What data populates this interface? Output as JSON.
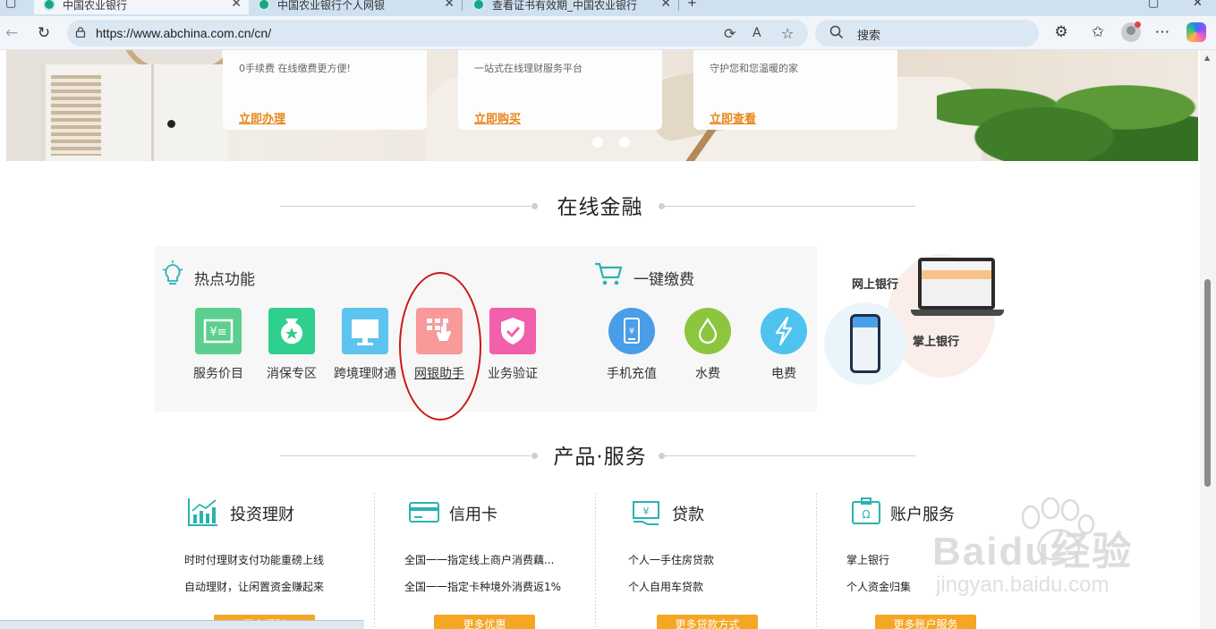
{
  "browser": {
    "tabs": [
      {
        "title": "中国农业银行"
      },
      {
        "title": "中国农业银行个人网银"
      },
      {
        "title": "查看证书有效期_中国农业银行"
      }
    ],
    "new_tab": "+",
    "url": "https://www.abchina.com.cn/cn/",
    "search_placeholder": "搜索"
  },
  "banner": {
    "promos": [
      {
        "desc": "0手续费 在线缴费更方便!",
        "cta": "立即办理"
      },
      {
        "desc": "一站式在线理财服务平台",
        "cta": "立即购买"
      },
      {
        "desc": "守护您和您温暖的家",
        "cta": "立即查看"
      }
    ]
  },
  "online_finance": {
    "title": "在线金融",
    "hot": {
      "title": "热点功能",
      "items": [
        {
          "label": "服务价目",
          "icon": "price-list-icon",
          "color": "#5ccf8f"
        },
        {
          "label": "消保专区",
          "icon": "consumer-protection-icon",
          "color": "#2fcf8e"
        },
        {
          "label": "跨境理财通",
          "icon": "monitor-icon",
          "color": "#5ec3ef"
        },
        {
          "label": "网银助手",
          "icon": "ebank-assistant-icon",
          "color": "#f79a99"
        },
        {
          "label": "业务验证",
          "icon": "shield-check-icon",
          "color": "#f25fab"
        }
      ]
    },
    "pay": {
      "title": "一键缴费",
      "items": [
        {
          "label": "手机充值",
          "icon": "mobile-recharge-icon",
          "color": "#4a9de8"
        },
        {
          "label": "水费",
          "icon": "water-drop-icon",
          "color": "#8cc63f"
        },
        {
          "label": "电费",
          "icon": "lightning-icon",
          "color": "#4fc3f0"
        }
      ]
    },
    "ebank": {
      "online": "网上银行",
      "mobile": "掌上银行"
    }
  },
  "products": {
    "title": "产品·服务",
    "items": [
      {
        "title": "投资理财",
        "lines": [
          "时时付理财支付功能重磅上线",
          "自动理财，让闲置资金赚起来"
        ],
        "button": "更多理财"
      },
      {
        "title": "信用卡",
        "lines": [
          "全国一一指定线上商户消费藕...",
          "全国一一指定卡种境外消费返1%"
        ],
        "button": "更多优惠"
      },
      {
        "title": "贷款",
        "lines": [
          "个人一手住房贷款",
          "个人自用车贷款"
        ],
        "button": "更多贷款方式"
      },
      {
        "title": "账户服务",
        "lines": [
          "掌上银行",
          "个人资金归集"
        ],
        "button": "更多账户服务"
      }
    ]
  },
  "watermark": {
    "brand": "Baidu经验",
    "url": "jingyan.baidu.com"
  },
  "colors": {
    "accent_orange": "#f5a623",
    "cta_orange": "#e8861a",
    "teal_icon": "#2ab3b1",
    "highlight_red": "#c91919"
  }
}
